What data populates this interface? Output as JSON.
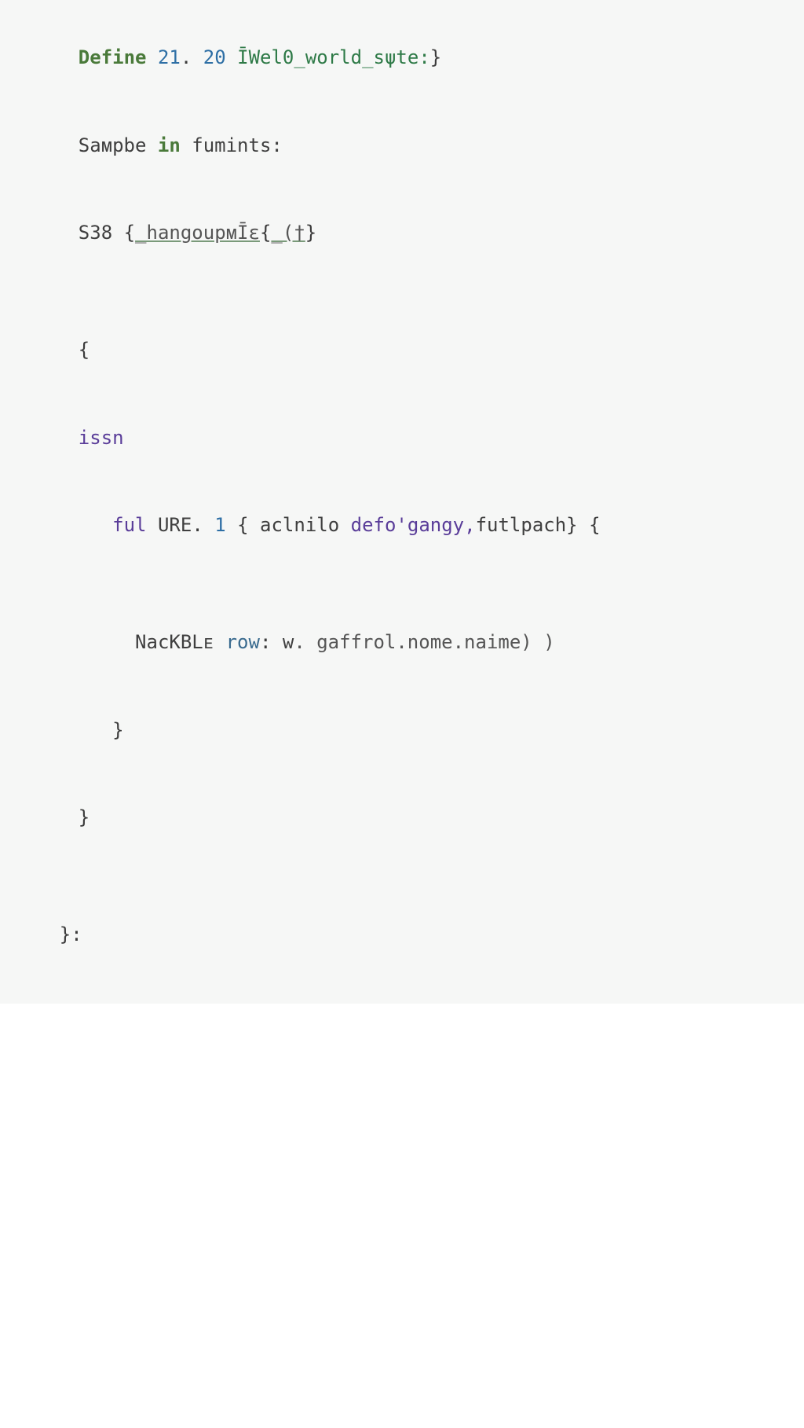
{
  "code": {
    "line1": {
      "kw_define": "Define ",
      "num1": "21",
      "dot": ". ",
      "num2": "20",
      "space": " ",
      "str": "ῙWel0_world_sψte:",
      "close": "}"
    },
    "line2": {
      "part1": "Saᴍpbe ",
      "kw_in": "in",
      "part2": " fumints:"
    },
    "line3": {
      "s38": "S38 ",
      "brace": "{",
      "ident": "_hangoupᴍῙε",
      "mid": "{",
      "under": "_(†",
      "close": "}"
    },
    "line5": {
      "brace": "{"
    },
    "line6": {
      "issn": "issn"
    },
    "line7": {
      "indent": "   ",
      "ful": "ful ",
      "ure": "URE",
      "dot": ". ",
      "one": "1",
      "space": " ",
      "brace1": "{",
      "mid": " aclnilo ",
      "defo": "defo'gangy,",
      "futl": "futlpach",
      "brace2": "} ",
      "brace3": "{"
    },
    "line9": {
      "indent": "     ",
      "nack": "NacKBLᴇ ",
      "row": "row",
      "colon": ": ",
      "w": "w",
      "dot": ". gaffrol.nome.naime) )"
    },
    "line10": {
      "indent": "   ",
      "brace": "}"
    },
    "line11": {
      "brace": "}"
    },
    "line13": {
      "brace": "}:"
    }
  },
  "colors": {
    "background_code": "#f6f7f6",
    "keyword_green": "#4a7a3a",
    "number_blue": "#2e6fa5",
    "string_green": "#2e7a47",
    "identifier_purple": "#5a3d99",
    "text_dark": "#333333"
  }
}
